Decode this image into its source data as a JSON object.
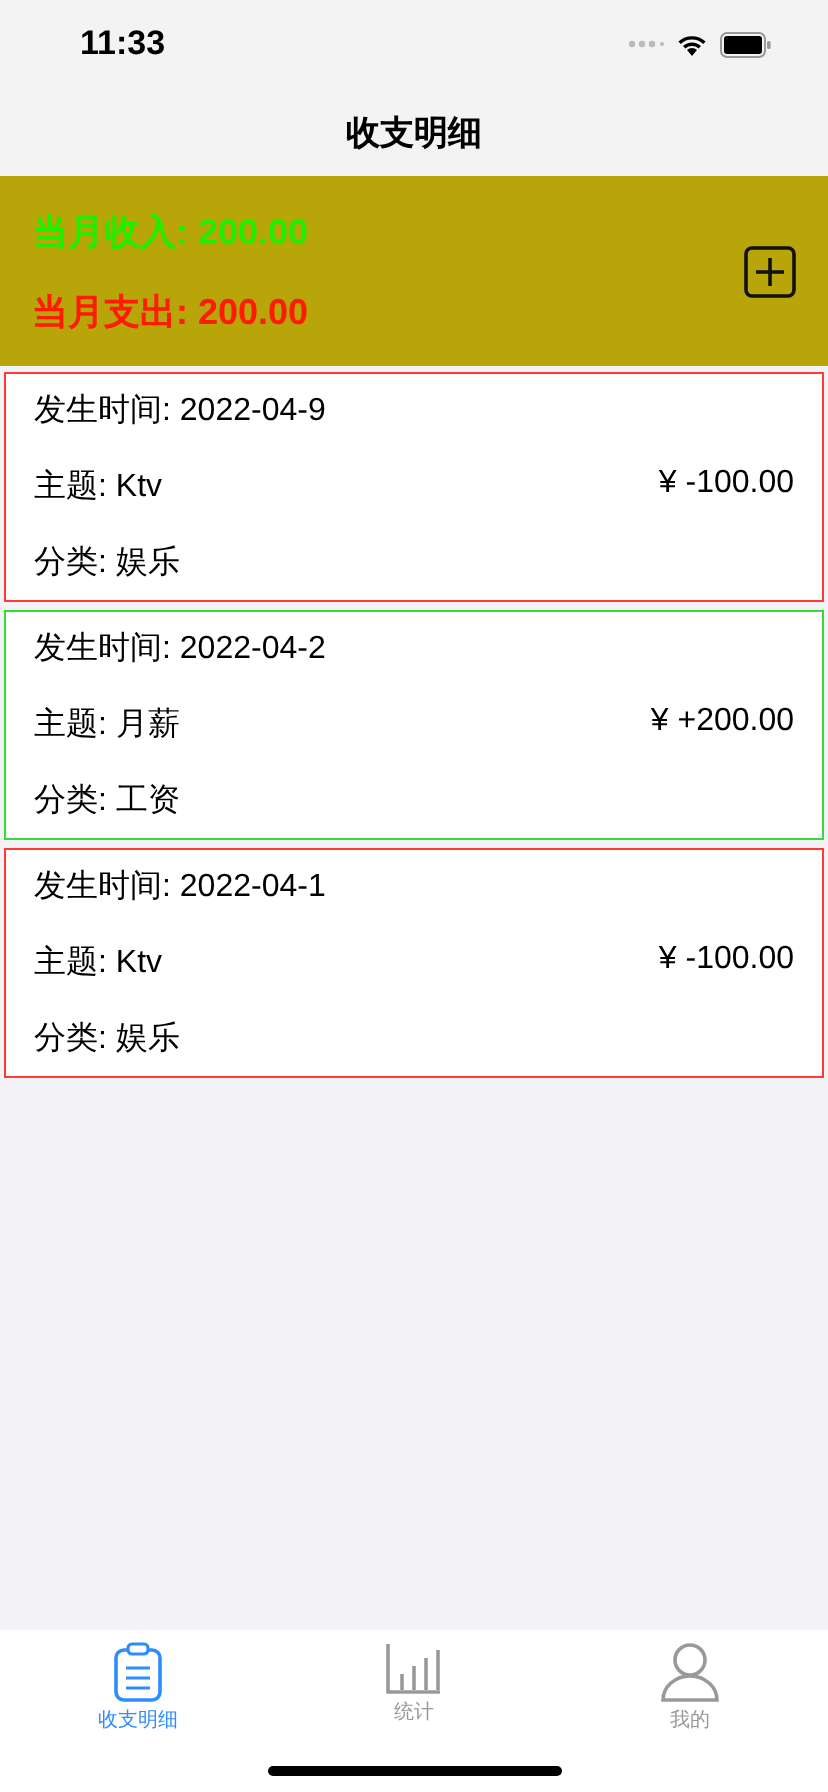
{
  "status_bar": {
    "time": "11:33"
  },
  "nav": {
    "title": "收支明细"
  },
  "summary": {
    "income": "当月收入: 200.00",
    "expense": "当月支出: 200.00"
  },
  "records": [
    {
      "time": "发生时间: 2022-04-9",
      "subject": "主题: Ktv",
      "amount": "¥  -100.00",
      "category": "分类: 娱乐",
      "color": "#ff3b30"
    },
    {
      "time": "发生时间: 2022-04-2",
      "subject": "主题: 月薪",
      "amount": "¥  +200.00",
      "category": "分类: 工资",
      "color": "#33dd33"
    },
    {
      "time": "发生时间: 2022-04-1",
      "subject": "主题: Ktv",
      "amount": "¥  -100.00",
      "category": "分类: 娱乐",
      "color": "#ff3b30"
    }
  ],
  "tabs": [
    {
      "label": "收支明细",
      "kind": "clipboard",
      "selected": true
    },
    {
      "label": "统计",
      "kind": "chart",
      "selected": false
    },
    {
      "label": "我的",
      "kind": "person",
      "selected": false
    }
  ]
}
